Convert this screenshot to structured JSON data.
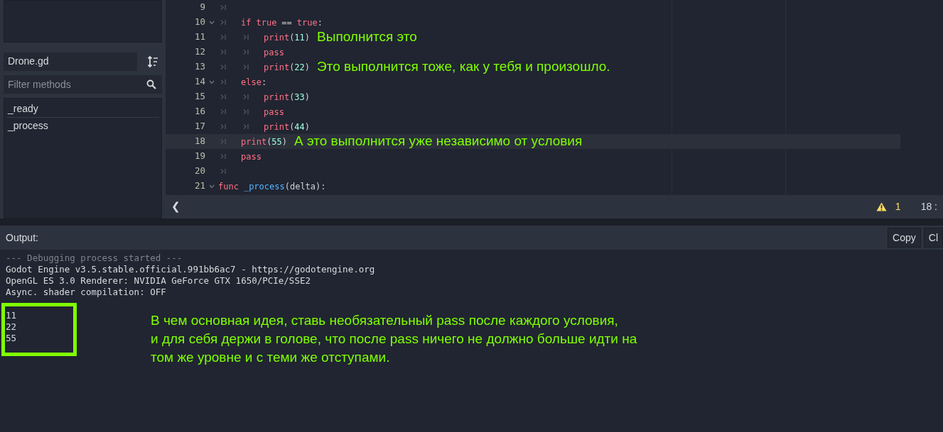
{
  "sidebar": {
    "script_name": "Drone.gd",
    "filter": {
      "placeholder": "Filter methods"
    },
    "methods": [
      {
        "label": "_ready",
        "selected": false
      },
      {
        "label": "_process",
        "selected": false
      }
    ]
  },
  "editor": {
    "lines": [
      {
        "number": "9",
        "foldable": false,
        "current": false,
        "tokens": [
          {
            "kind": "tab"
          }
        ]
      },
      {
        "number": "10",
        "foldable": true,
        "current": false,
        "tokens": [
          {
            "kind": "tab"
          },
          {
            "kind": "keyword",
            "text": "if"
          },
          {
            "kind": "space"
          },
          {
            "kind": "keyword",
            "text": "true"
          },
          {
            "kind": "space"
          },
          {
            "kind": "plain",
            "text": "=="
          },
          {
            "kind": "space"
          },
          {
            "kind": "keyword",
            "text": "true"
          },
          {
            "kind": "plain",
            "text": ":"
          }
        ]
      },
      {
        "number": "11",
        "foldable": false,
        "current": false,
        "tokens": [
          {
            "kind": "tab"
          },
          {
            "kind": "tab"
          },
          {
            "kind": "keyword",
            "text": "print"
          },
          {
            "kind": "plain",
            "text": "("
          },
          {
            "kind": "number",
            "text": "11"
          },
          {
            "kind": "plain",
            "text": ")"
          }
        ],
        "note": "Выполнится это"
      },
      {
        "number": "12",
        "foldable": false,
        "current": false,
        "tokens": [
          {
            "kind": "tab"
          },
          {
            "kind": "tab"
          },
          {
            "kind": "keyword",
            "text": "pass"
          }
        ]
      },
      {
        "number": "13",
        "foldable": false,
        "current": false,
        "tokens": [
          {
            "kind": "tab"
          },
          {
            "kind": "tab"
          },
          {
            "kind": "keyword",
            "text": "print"
          },
          {
            "kind": "plain",
            "text": "("
          },
          {
            "kind": "number",
            "text": "22"
          },
          {
            "kind": "plain",
            "text": ")"
          }
        ],
        "note": "Это выполнится тоже, как у тебя и произошло."
      },
      {
        "number": "14",
        "foldable": true,
        "current": false,
        "tokens": [
          {
            "kind": "tab"
          },
          {
            "kind": "keyword",
            "text": "else"
          },
          {
            "kind": "plain",
            "text": ":"
          }
        ]
      },
      {
        "number": "15",
        "foldable": false,
        "current": false,
        "tokens": [
          {
            "kind": "tab"
          },
          {
            "kind": "tab"
          },
          {
            "kind": "keyword",
            "text": "print"
          },
          {
            "kind": "plain",
            "text": "("
          },
          {
            "kind": "number",
            "text": "33"
          },
          {
            "kind": "plain",
            "text": ")"
          }
        ]
      },
      {
        "number": "16",
        "foldable": false,
        "current": false,
        "tokens": [
          {
            "kind": "tab"
          },
          {
            "kind": "tab"
          },
          {
            "kind": "keyword",
            "text": "pass"
          }
        ]
      },
      {
        "number": "17",
        "foldable": false,
        "current": false,
        "tokens": [
          {
            "kind": "tab"
          },
          {
            "kind": "tab"
          },
          {
            "kind": "keyword",
            "text": "print"
          },
          {
            "kind": "plain",
            "text": "("
          },
          {
            "kind": "number",
            "text": "44"
          },
          {
            "kind": "plain",
            "text": ")"
          }
        ]
      },
      {
        "number": "18",
        "foldable": false,
        "current": true,
        "tokens": [
          {
            "kind": "tab"
          },
          {
            "kind": "keyword",
            "text": "print"
          },
          {
            "kind": "plain",
            "text": "("
          },
          {
            "kind": "number",
            "text": "55"
          },
          {
            "kind": "plain",
            "text": ")"
          }
        ],
        "note": "А это выполнится уже независимо от условия"
      },
      {
        "number": "19",
        "foldable": false,
        "current": false,
        "tokens": [
          {
            "kind": "tab"
          },
          {
            "kind": "keyword",
            "text": "pass"
          }
        ]
      },
      {
        "number": "20",
        "foldable": false,
        "current": false,
        "tokens": [
          {
            "kind": "tab"
          }
        ]
      },
      {
        "number": "21",
        "foldable": true,
        "current": false,
        "tokens": [
          {
            "kind": "keyword",
            "text": "func"
          },
          {
            "kind": "space"
          },
          {
            "kind": "function",
            "text": "_process"
          },
          {
            "kind": "plain",
            "text": "(delta):"
          }
        ]
      }
    ]
  },
  "status_bar": {
    "scroll_left": "❮",
    "warnings": "1",
    "position": "18 :"
  },
  "output": {
    "title": "Output:",
    "buttons": [
      "Copy",
      "Cl"
    ],
    "lines": [
      {
        "kind": "dim",
        "text": "--- Debugging process started ---"
      },
      {
        "kind": "normal",
        "text": "Godot Engine v3.5.stable.official.991bb6ac7 - https://godotengine.org"
      },
      {
        "kind": "normal",
        "text": "OpenGL ES 3.0 Renderer: NVIDIA GeForce GTX 1650/PCIe/SSE2"
      },
      {
        "kind": "normal",
        "text": "Async. shader compilation: OFF"
      }
    ],
    "printed": [
      "11",
      "22",
      "55"
    ],
    "note": [
      "В чем основная идея, ставь необязательный pass после каждого условия,",
      "и для себя держи в голове, что после pass ничего не должно больше идти на",
      "том же уровне и с теми же отступами."
    ]
  }
}
